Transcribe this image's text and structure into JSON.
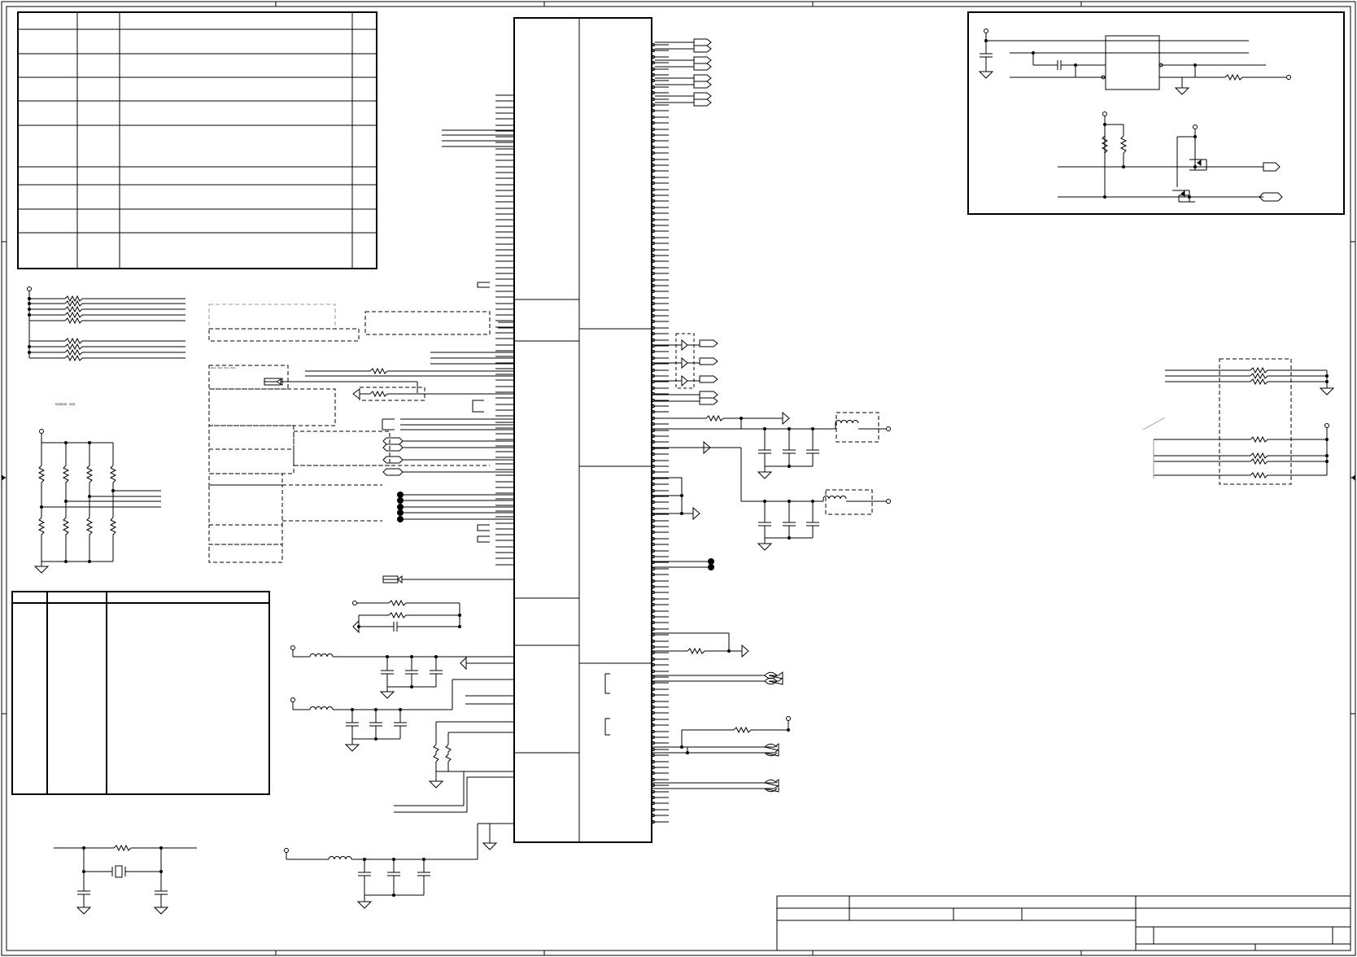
{
  "schematic": {
    "label_note": "▫▫▫▫ ▫▫",
    "tiny_label": "▫▫▫ ▫▫▫ ▫▫▫ ▫▫▫",
    "colors": {
      "ink": "#000000",
      "grey": "#9a9a9a",
      "paper": "#ffffff"
    }
  }
}
